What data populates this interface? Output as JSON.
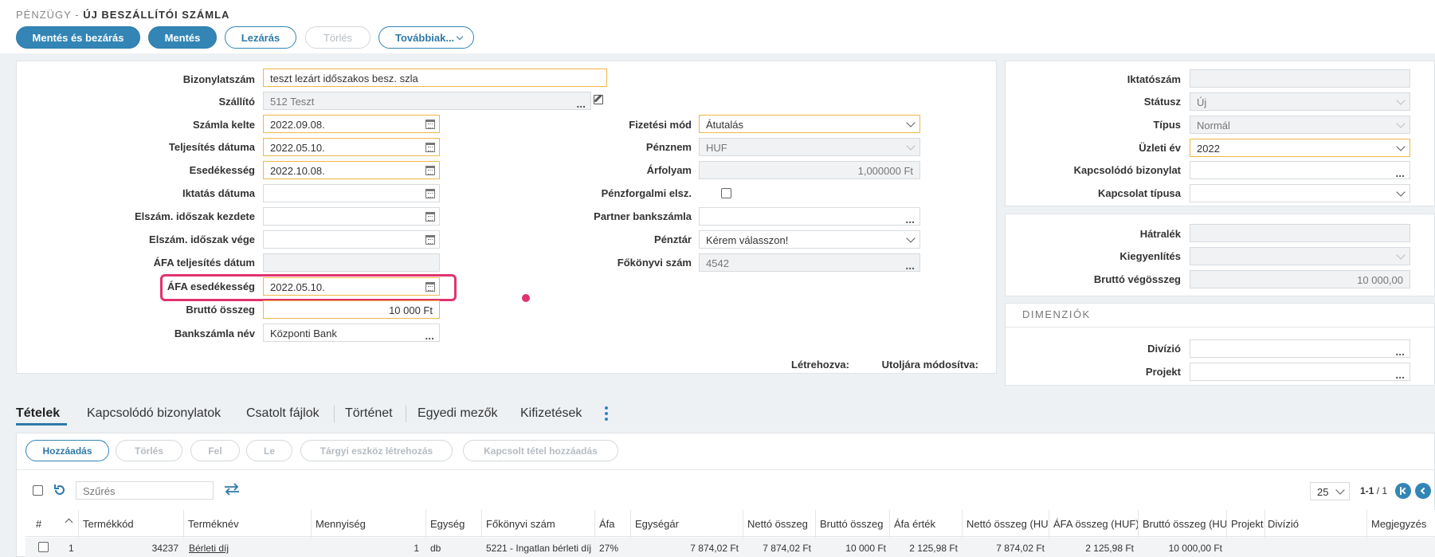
{
  "breadcrumb": {
    "section": "PÉNZÜGY -",
    "title": "ÚJ BESZÁLLÍTÓI SZÁMLA"
  },
  "toolbar": {
    "save_close": "Mentés és bezárás",
    "save": "Mentés",
    "lock": "Lezárás",
    "delete": "Törlés",
    "more": "Továbbiak..."
  },
  "form": {
    "bizonylatszam": {
      "label": "Bizonylatszám",
      "value": "teszt lezárt időszakos besz. szla"
    },
    "szallito": {
      "label": "Szállító",
      "value": "512 Teszt"
    },
    "szamla_kelte": {
      "label": "Számla kelte",
      "value": "2022.09.08."
    },
    "teljesites": {
      "label": "Teljesítés dátuma",
      "value": "2022.05.10."
    },
    "esedekesseg": {
      "label": "Esedékesség",
      "value": "2022.10.08."
    },
    "iktatas": {
      "label": "Iktatás dátuma",
      "value": ""
    },
    "idoszak_kezdete": {
      "label": "Elszám. időszak kezdete",
      "value": ""
    },
    "idoszak_vege": {
      "label": "Elszám. időszak vége",
      "value": ""
    },
    "afa_teljesites": {
      "label": "ÁFA teljesítés dátum",
      "value": ""
    },
    "afa_esedekesseg": {
      "label": "ÁFA esedékesség",
      "value": "2022.05.10."
    },
    "brutto": {
      "label": "Bruttó összeg",
      "value": "10 000 Ft"
    },
    "bankszamla_nev": {
      "label": "Bankszámla név",
      "value": "Központi Bank"
    },
    "fizetesi_mod": {
      "label": "Fizetési mód",
      "value": "Átutalás"
    },
    "penznem": {
      "label": "Pénznem",
      "value": "HUF"
    },
    "arfolyam": {
      "label": "Árfolyam",
      "value": "1,000000 Ft"
    },
    "penzforgalmi": {
      "label": "Pénzforgalmi elsz."
    },
    "partner_bankszamla": {
      "label": "Partner bankszámla",
      "value": ""
    },
    "penztar": {
      "label": "Pénztár",
      "value": "Kérem válasszon!"
    },
    "fokonyvi": {
      "label": "Főkönyvi szám",
      "value": "4542"
    },
    "letrehozva": "Létrehozva:",
    "utoljara": "Utoljára módosítva:"
  },
  "side": {
    "iktatoszam": {
      "label": "Iktatószám",
      "value": ""
    },
    "statusz": {
      "label": "Státusz",
      "value": "Új"
    },
    "tipus": {
      "label": "Típus",
      "value": "Normál"
    },
    "uzleti_ev": {
      "label": "Üzleti év",
      "value": "2022"
    },
    "kapcsolodo": {
      "label": "Kapcsolódó bizonylat",
      "value": ""
    },
    "kapcsolat_tipusa": {
      "label": "Kapcsolat típusa",
      "value": ""
    },
    "hatralek": {
      "label": "Hátralék",
      "value": ""
    },
    "kiegyenlites": {
      "label": "Kiegyenlítés",
      "value": ""
    },
    "brutto_vegosszeg": {
      "label": "Bruttó végösszeg",
      "value": "10 000,00"
    },
    "dimenziok": "DIMENZIÓK",
    "divizio": {
      "label": "Divízió",
      "value": ""
    },
    "projekt": {
      "label": "Projekt",
      "value": ""
    }
  },
  "tabs": [
    "Tételek",
    "Kapcsolódó bizonylatok",
    "Csatolt fájlok",
    "Történet",
    "Egyedi mezők",
    "Kifizetések"
  ],
  "items_toolbar": {
    "add": "Hozzáadás",
    "delete": "Törlés",
    "up": "Fel",
    "down": "Le",
    "asset": "Tárgyi eszköz létrehozás",
    "linked": "Kapcsolt tétel hozzáadás"
  },
  "filter": {
    "placeholder": "Szűrés"
  },
  "pager": {
    "page_size": "25",
    "range": "1-1",
    "total": "/ 1"
  },
  "grid": {
    "headers": [
      "#",
      "Termékkód",
      "Terméknév",
      "Mennyiség",
      "Egység",
      "Főkönyvi szám",
      "Áfa",
      "Egységár",
      "Nettó összeg",
      "Bruttó összeg",
      "Áfa érték",
      "Nettó összeg (HUF)",
      "ÁFA összeg (HUF)",
      "Bruttó összeg (HUF)",
      "Projekt",
      "Divízió",
      "Megjegyzés"
    ],
    "rows": [
      [
        "1",
        "34237",
        "Bérleti díj",
        "1",
        "db",
        "5221 - Ingatlan bérleti díj",
        "27%",
        "7 874,02 Ft",
        "7 874,02 Ft",
        "10 000 Ft",
        "2 125,98 Ft",
        "7 874,02 Ft",
        "2 125,98 Ft",
        "10 000,00 Ft",
        "",
        "",
        ""
      ]
    ]
  },
  "colors": {
    "primary": "#3385b5",
    "required_border": "#f0b648",
    "highlight": "#e0336e"
  }
}
